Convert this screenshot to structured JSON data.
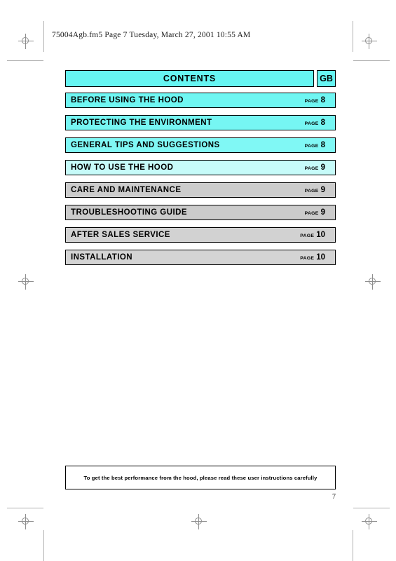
{
  "document": {
    "header_line": "75004Agb.fm5  Page 7  Tuesday, March 27, 2001  10:55 AM",
    "folio": "7",
    "footer_note": "To get the best performance from the hood, please read these user instructions carefully"
  },
  "contents": {
    "title": "CONTENTS",
    "language_code": "GB",
    "page_word": "PAGE",
    "entries": [
      {
        "label": "BEFORE USING THE HOOD",
        "page_word": "PAGE",
        "page": "8",
        "fill": "#6FF6F2"
      },
      {
        "label": "PROTECTING THE ENVIRONMENT",
        "page_word": "PAGE",
        "page": "8",
        "fill": "#76F6F3"
      },
      {
        "label": "GENERAL TIPS AND SUGGESTIONS",
        "page_word": "PAGE",
        "page": "8",
        "fill": "#80F8F5"
      },
      {
        "label": "HOW TO USE THE HOOD",
        "page_word": "PAGE",
        "page": "9",
        "fill": "#C6FBF9"
      },
      {
        "label": "CARE AND MAINTENANCE",
        "page_word": "PAGE",
        "page": "9",
        "fill": "#CCCCCC"
      },
      {
        "label": "TROUBLESHOOTING GUIDE",
        "page_word": "PAGE",
        "page": "9",
        "fill": "#CBCBCB"
      },
      {
        "label": "AFTER SALES SERVICE",
        "page_word": "PAGE",
        "page": "10",
        "fill": "#D2D2D2"
      },
      {
        "label": "INSTALLATION",
        "page_word": "PAGE",
        "page": "10",
        "fill": "#D4D4D4"
      }
    ]
  },
  "colors": {
    "header_cyan": "#66F5F2",
    "page_white": "#FFFFFF",
    "rule_black": "#000000",
    "mark_gray": "#8E8E8E"
  }
}
